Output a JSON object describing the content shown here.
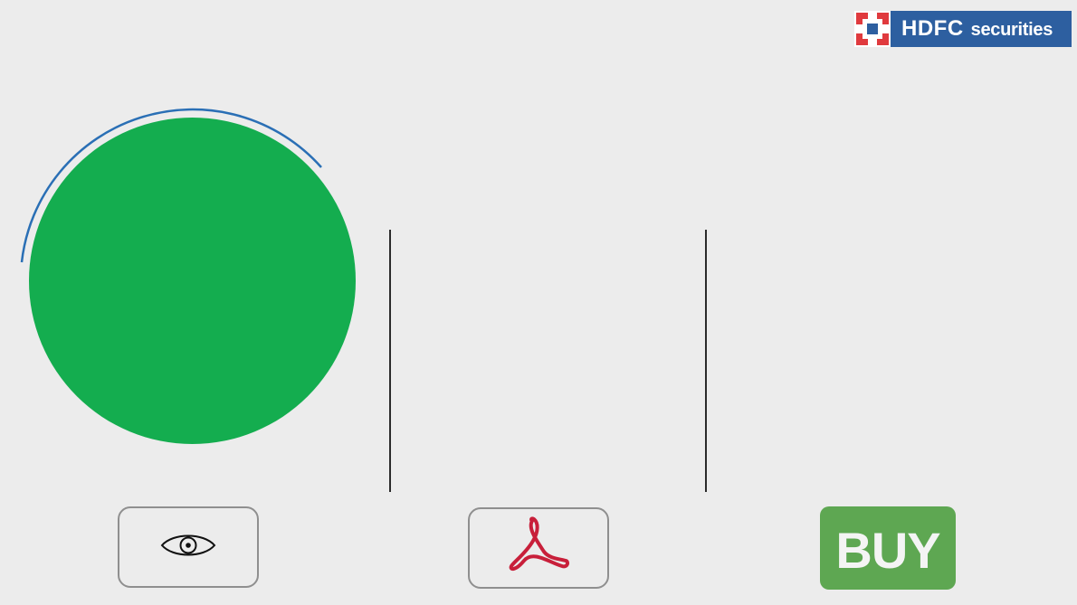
{
  "brand": {
    "name": "HDFC",
    "suffix": "securities",
    "colors": {
      "blue": "#2d5fa0",
      "red": "#e03a3e"
    }
  },
  "hero": {
    "circle_color": "#14ad4f",
    "arc_color": "#2a6fb5"
  },
  "actions": {
    "view_icon": "eye-icon",
    "pdf_icon": "acrobat-pdf-icon",
    "buy_label": "BUY",
    "buy_color": "#5ea752"
  }
}
